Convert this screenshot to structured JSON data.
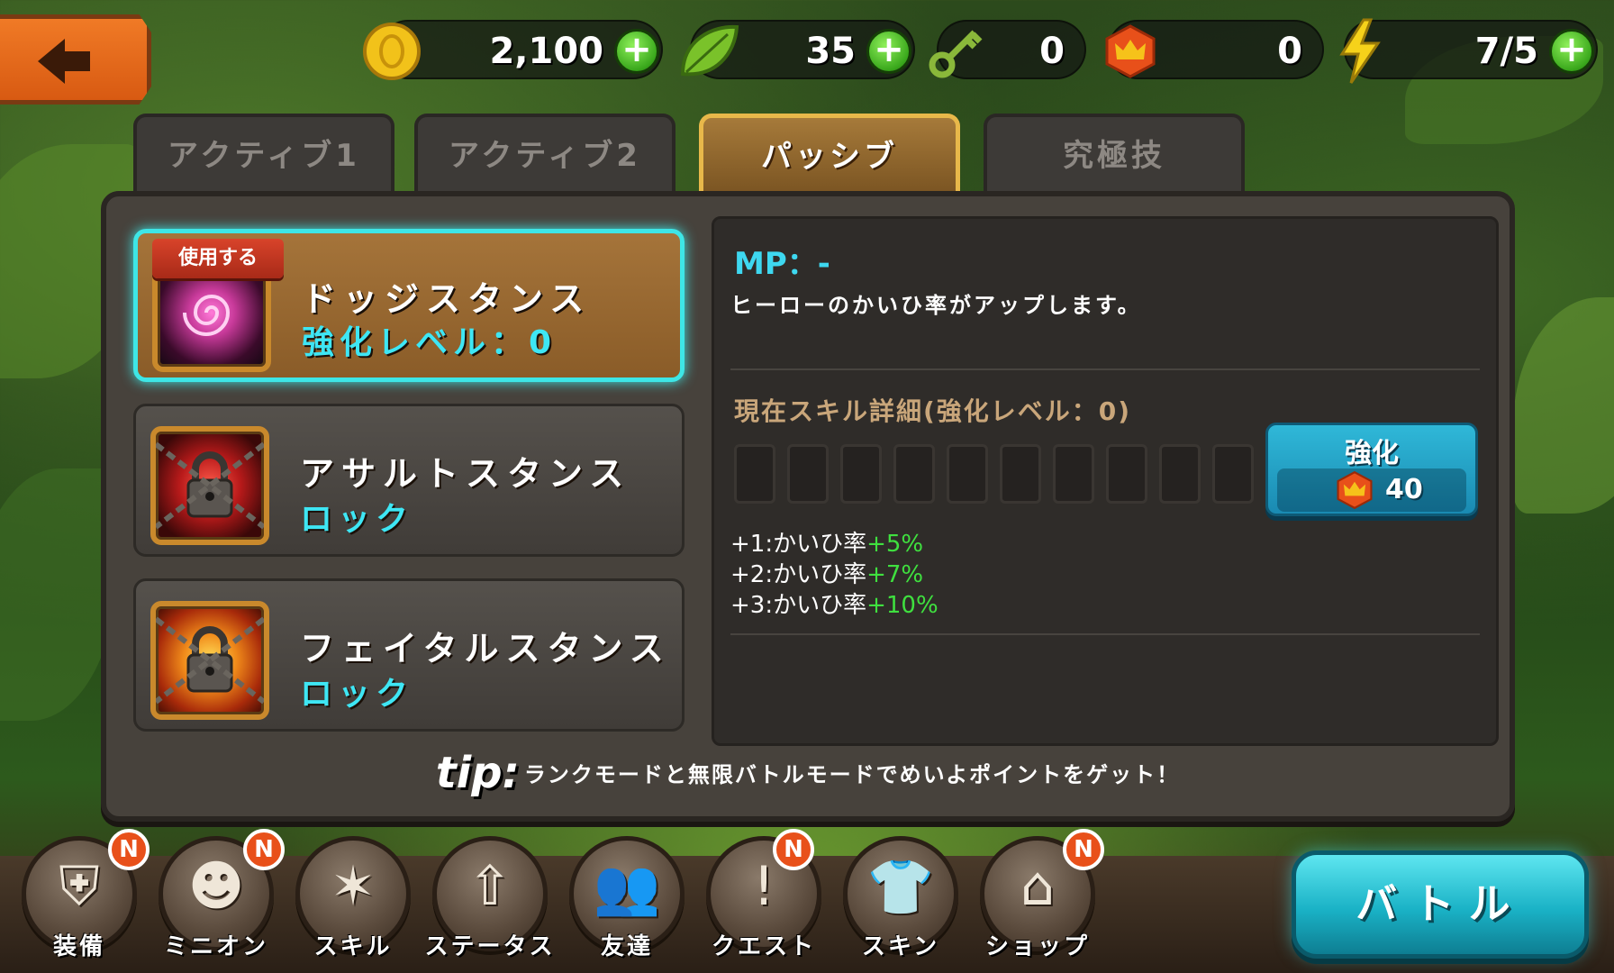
{
  "topbar": {
    "back_icon": "back-arrow-icon",
    "coins": {
      "value": "2,100",
      "icon": "coin-icon"
    },
    "leaves": {
      "value": "35",
      "icon": "leaf-icon"
    },
    "keys": {
      "value": "0",
      "icon": "key-icon"
    },
    "crowns": {
      "value": "0",
      "icon": "crown-icon"
    },
    "energy": {
      "value": "7/5",
      "icon": "lightning-icon"
    }
  },
  "tabs": [
    {
      "label": "アクティブ1"
    },
    {
      "label": "アクティブ2"
    },
    {
      "label": "パッシブ"
    },
    {
      "label": "究極技"
    }
  ],
  "skills": [
    {
      "ribbon": "使用する",
      "name": "ドッジスタンス",
      "sub": "強化レベル：0"
    },
    {
      "name": "アサルトスタンス",
      "sub": "ロック"
    },
    {
      "name": "フェイタルスタンス",
      "sub": "ロック"
    }
  ],
  "detail": {
    "mp": "MP：-",
    "description": "ヒーローのかいひ率がアップします。",
    "current_title": "現在スキル詳細(強化レベル：0)",
    "upgrade_label": "強化",
    "upgrade_cost": "40",
    "effects": [
      {
        "prefix": "+1:かいひ率",
        "value": "+5%"
      },
      {
        "prefix": "+2:かいひ率",
        "value": "+7%"
      },
      {
        "prefix": "+3:かいひ率",
        "value": "+10%"
      }
    ]
  },
  "tip": {
    "word": "tip:",
    "text": "ランクモードと無限バトルモードでめいよポイントをゲット！"
  },
  "nav": [
    {
      "label": "装備",
      "badge": "N"
    },
    {
      "label": "ミニオン",
      "badge": "N"
    },
    {
      "label": "スキル",
      "badge": ""
    },
    {
      "label": "ステータス",
      "badge": ""
    },
    {
      "label": "友達",
      "badge": ""
    },
    {
      "label": "クエスト",
      "badge": "N"
    },
    {
      "label": "スキン",
      "badge": ""
    },
    {
      "label": "ショップ",
      "badge": "N"
    }
  ],
  "battle_label": "バトル"
}
